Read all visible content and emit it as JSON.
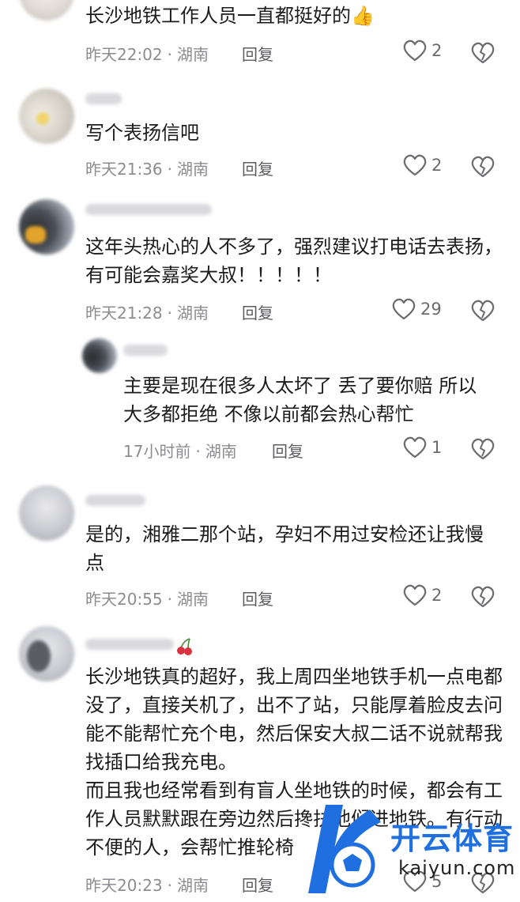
{
  "comments": [
    {
      "text": "长沙地铁工作人员一直都挺好的",
      "emoji": "👍",
      "time": "昨天22:02",
      "location": "湖南",
      "reply_label": "回复",
      "likes": "2"
    },
    {
      "text": "写个表扬信吧",
      "time": "昨天21:36",
      "location": "湖南",
      "reply_label": "回复",
      "likes": "2"
    },
    {
      "text": "这年头热心的人不多了，强烈建议打电话去表扬，有可能会嘉奖大叔！！！！！",
      "time": "昨天21:28",
      "location": "湖南",
      "reply_label": "回复",
      "likes": "29"
    },
    {
      "text": "主要是现在很多人太坏了 丢了要你赔 所以大多都拒绝 不像以前都会热心帮忙",
      "time": "17小时前",
      "location": "湖南",
      "reply_label": "回复",
      "likes": "1"
    },
    {
      "text": "是的，湘雅二那个站，孕妇不用过安检还让我慢点",
      "time": "昨天20:55",
      "location": "湖南",
      "reply_label": "回复",
      "likes": "2"
    },
    {
      "text": "长沙地铁真的超好，我上周四坐地铁手机一点电都没了，直接关机了，出不了站，只能厚着脸皮去问能不能帮忙充个电，然后保安大叔二话不说就帮我找插口给我充电。\n而且我也经常看到有盲人坐地铁的时候，都会有工作人员默默跟在旁边然后搀扶他们进地铁。有行动不便的人，会帮忙推轮椅",
      "time": "昨天20:23",
      "location": "湖南",
      "reply_label": "回复",
      "likes": "5"
    }
  ],
  "watermark": {
    "brand": "开云体育",
    "domain": "kaiyun.com"
  },
  "colors": {
    "meta": "#8c8c92",
    "text": "#1c1c1c",
    "icon": "#6a6a70"
  }
}
